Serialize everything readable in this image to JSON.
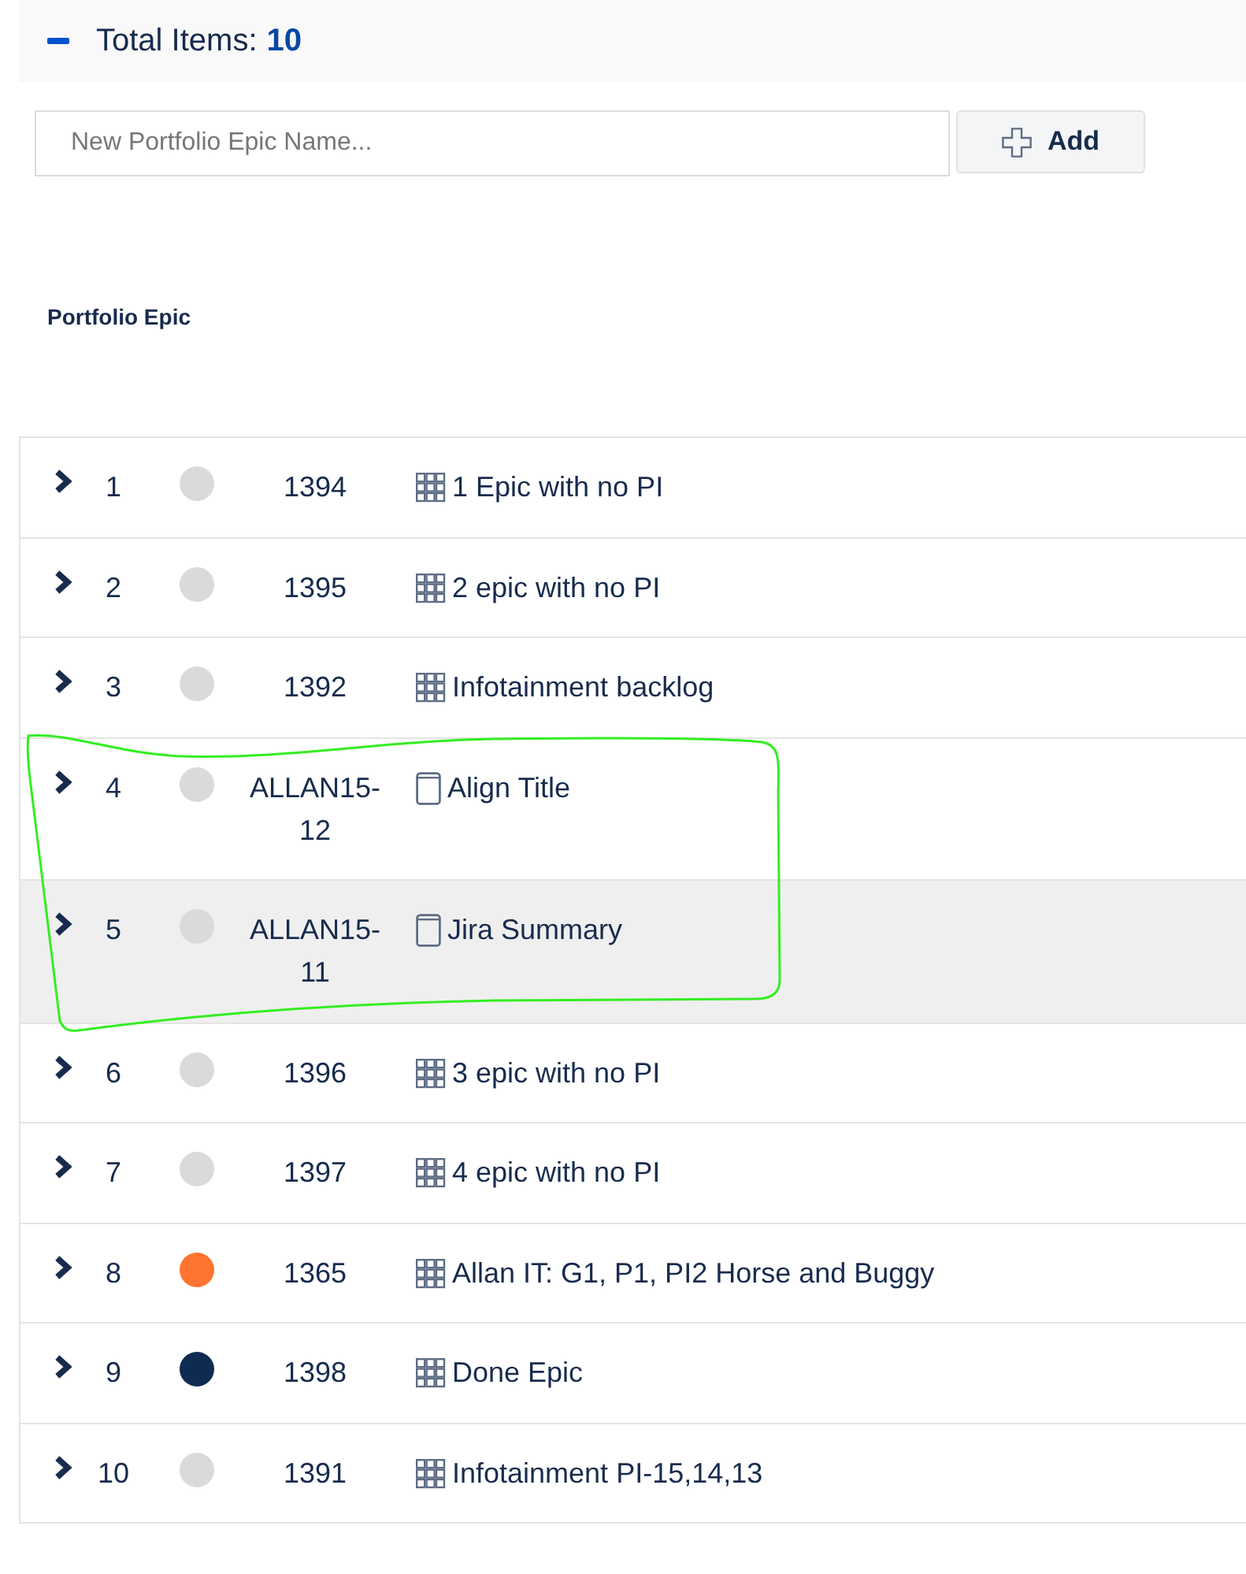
{
  "section": {
    "expanded": true,
    "label": "Total Items:",
    "count": "10"
  },
  "new_epic": {
    "placeholder": "New Portfolio Epic Name...",
    "button": "Add"
  },
  "table": {
    "columns": [
      {
        "label": "Portfolio Epic"
      }
    ],
    "rows": [
      {
        "number": "1",
        "color": "#dadada",
        "key": "1394",
        "kind": "epic",
        "title": "1 Epic with no PI",
        "expanded": false,
        "selected": false
      },
      {
        "number": "2",
        "color": "#dadada",
        "key": "1395",
        "kind": "epic",
        "title": "2 epic with no PI",
        "expanded": false,
        "selected": false
      },
      {
        "number": "3",
        "color": "#dadada",
        "key": "1392",
        "kind": "epic",
        "title": "Infotainment backlog",
        "expanded": false,
        "selected": false
      },
      {
        "number": "4",
        "color": "#dadada",
        "key": "ALLAN15-12",
        "kind": "issue",
        "title": "Align Title",
        "expanded": false,
        "selected": false
      },
      {
        "number": "5",
        "color": "#dadada",
        "key": "ALLAN15-11",
        "kind": "issue",
        "title": "Jira Summary",
        "expanded": false,
        "selected": true
      },
      {
        "number": "6",
        "color": "#dadada",
        "key": "1396",
        "kind": "epic",
        "title": "3 epic with no PI",
        "expanded": false,
        "selected": false
      },
      {
        "number": "7",
        "color": "#dadada",
        "key": "1397",
        "kind": "epic",
        "title": "4 epic with no PI",
        "expanded": false,
        "selected": false
      },
      {
        "number": "8",
        "color": "#ff7430",
        "key": "1365",
        "kind": "epic",
        "title": "Allan IT: G1, P1, PI2 Horse and Buggy",
        "expanded": false,
        "selected": false
      },
      {
        "number": "9",
        "color": "#0f2b52",
        "key": "1398",
        "kind": "epic",
        "title": "Done Epic",
        "expanded": false,
        "selected": false
      },
      {
        "number": "10",
        "color": "#dadada",
        "key": "1391",
        "kind": "epic",
        "title": "Infotainment PI-15,14,13",
        "expanded": false,
        "selected": false
      }
    ]
  }
}
